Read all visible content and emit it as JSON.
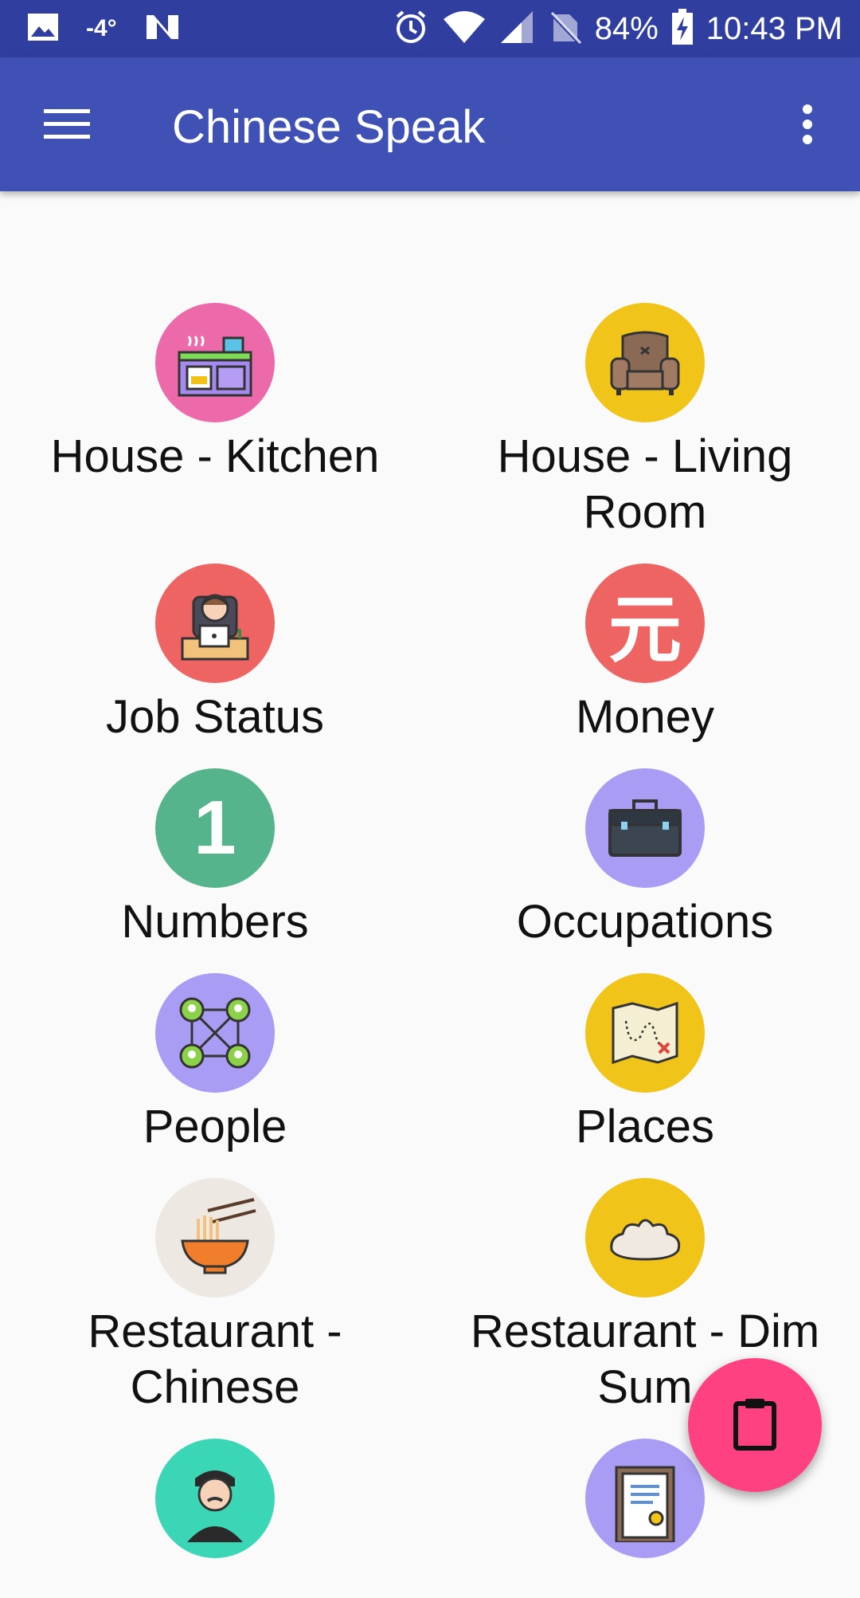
{
  "status_bar": {
    "temperature": "-4°",
    "battery": "84%",
    "time": "10:43 PM",
    "icons": [
      "image-icon",
      "n-icon",
      "alarm-icon",
      "wifi-icon",
      "signal-icon",
      "no-sim-icon",
      "battery-charging-icon"
    ]
  },
  "app_bar": {
    "title": "Chinese Speak",
    "menu_icon": "hamburger-menu-icon",
    "overflow_icon": "more-vert-icon"
  },
  "categories": [
    {
      "label": "House - Kitchen",
      "icon": "kitchen-icon",
      "color": "#ec6aa9"
    },
    {
      "label": "House - Living Room",
      "icon": "armchair-icon",
      "color": "#f0c419"
    },
    {
      "label": "Job Status",
      "icon": "office-worker-icon",
      "color": "#ee6462"
    },
    {
      "label": "Money",
      "icon": "yuan-icon",
      "glyph": "元",
      "color": "#ee6462"
    },
    {
      "label": "Numbers",
      "icon": "number-one-icon",
      "glyph": "1",
      "color": "#55b48b"
    },
    {
      "label": "Occupations",
      "icon": "briefcase-icon",
      "color": "#a89cf4"
    },
    {
      "label": "People",
      "icon": "people-network-icon",
      "color": "#a89cf4"
    },
    {
      "label": "Places",
      "icon": "treasure-map-icon",
      "color": "#f0c419"
    },
    {
      "label": "Restaurant - Chinese",
      "icon": "noodle-bowl-icon",
      "color": "#ede8e1"
    },
    {
      "label": "Restaurant - Dim Sum",
      "icon": "dumpling-icon",
      "color": "#f0c419"
    },
    {
      "label": "",
      "icon": "waiter-icon",
      "color": "#3bd6b6"
    },
    {
      "label": "",
      "icon": "certificate-icon",
      "color": "#a89cf4"
    }
  ],
  "fab": {
    "icon": "clipboard-icon",
    "color": "#ff4081"
  }
}
